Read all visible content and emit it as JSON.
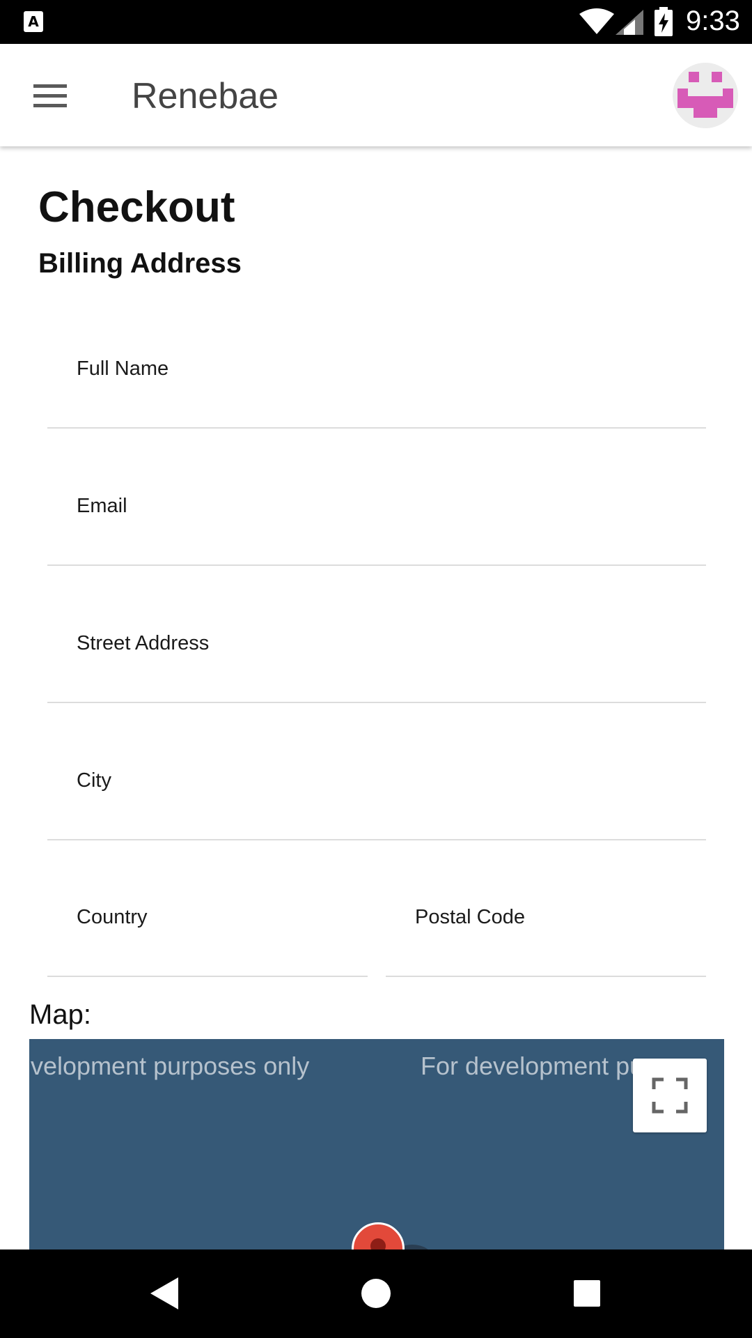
{
  "status_bar": {
    "notification_icon": "a-notification-icon",
    "time": "9:33"
  },
  "app_bar": {
    "title": "Renebae",
    "menu_icon": "hamburger-menu-icon",
    "avatar_color": "#d75bb7"
  },
  "page": {
    "title": "Checkout",
    "section": "Billing Address"
  },
  "form": {
    "full_name": {
      "label": "Full Name",
      "value": ""
    },
    "email": {
      "label": "Email",
      "value": ""
    },
    "street": {
      "label": "Street Address",
      "value": ""
    },
    "city": {
      "label": "City",
      "value": ""
    },
    "country": {
      "label": "Country",
      "value": ""
    },
    "postal": {
      "label": "Postal Code",
      "value": ""
    }
  },
  "map": {
    "label": "Map:",
    "watermark_left": "velopment purposes only",
    "watermark_right": "For development purpose",
    "fullscreen_icon": "fullscreen-icon",
    "background_color": "#365977",
    "marker_color": "#e2493a"
  },
  "nav_bar": {
    "back_icon": "back-triangle-icon",
    "home_icon": "home-circle-icon",
    "recents_icon": "recents-square-icon"
  }
}
